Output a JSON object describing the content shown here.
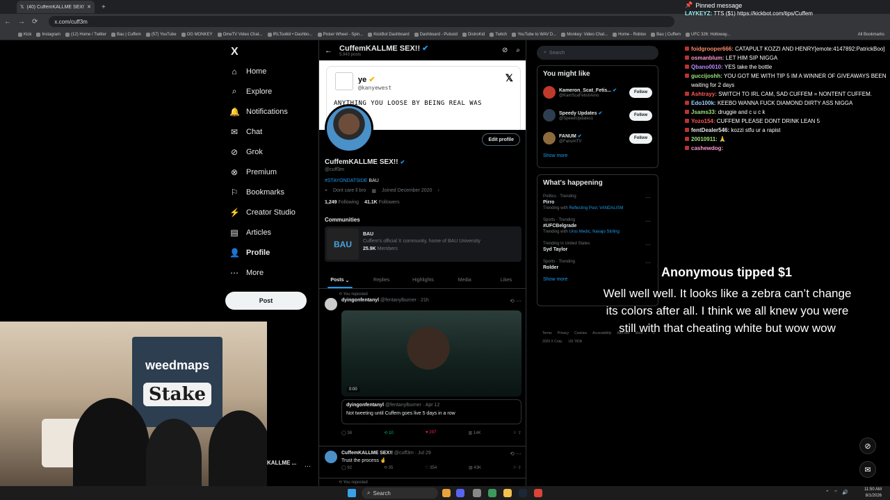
{
  "browser": {
    "tab_title": "(40) CuffemKALLME SEX!! (@cuff3m)",
    "url": "x.com/cuff3m",
    "bookmarks": [
      "Kick",
      "Instagram",
      "(12) Home / Twitter",
      "Bau | Cuffem",
      "(57) YouTube",
      "OG MONKEY",
      "OmeTV Video Chat...",
      "IRLToolkit • Dashbo...",
      "Picker Wheel - Spin...",
      "KickBot Dashboard",
      "Dashboard - Pulsoid",
      "DistroKid",
      "Twitch",
      "YouTube to WAV D...",
      "Monkey: Video Chat...",
      "Home - Roblox",
      "Bau | Cuffem",
      "UFC 326: Holloway..."
    ],
    "all_bookmarks": "All Bookmarks"
  },
  "nav": {
    "logo": "X",
    "items": [
      {
        "label": "Home",
        "icon": "⌂"
      },
      {
        "label": "Explore",
        "icon": "⌕"
      },
      {
        "label": "Notifications",
        "icon": "🔔"
      },
      {
        "label": "Chat",
        "icon": "✉"
      },
      {
        "label": "Grok",
        "icon": "⊘"
      },
      {
        "label": "Premium",
        "icon": "⊗"
      },
      {
        "label": "Bookmarks",
        "icon": "⚐"
      },
      {
        "label": "Creator Studio",
        "icon": "⚡"
      },
      {
        "label": "Articles",
        "icon": "▤"
      },
      {
        "label": "Profile",
        "icon": "👤"
      },
      {
        "label": "More",
        "icon": "⋯"
      }
    ],
    "post_label": "Post"
  },
  "profile": {
    "header_name": "CuffemKALLME SEX!!",
    "header_posts": "5,943 posts",
    "banner": {
      "name": "ye",
      "handle": "@kanyewest",
      "text": "ANYTHING YOU LOOSE BY BEING REAL WAS"
    },
    "edit_label": "Edit profile",
    "name": "CuffemKALLME SEX!!",
    "handle": "@cuff3m",
    "bio_tag": "#STAYONDATSIDE",
    "bio_rest": " BAU",
    "location": "Dont care ll bro",
    "joined": "Joined December 2020",
    "following_count": "1,249",
    "following_label": "Following",
    "followers_count": "41.1K",
    "followers_label": "Followers",
    "communities_title": "Communities",
    "community": {
      "name": "BAU",
      "desc": "Cuffem's official X community, home of BAU University",
      "members_count": "25.9K",
      "members_label": "Members"
    },
    "tabs": [
      "Posts",
      "Replies",
      "Highlights",
      "Media",
      "Likes"
    ]
  },
  "posts": [
    {
      "reposted": "You reposted",
      "name": "dyingonfentanyl",
      "handle": "@fentanylburner · 21h",
      "media_time": "0:00",
      "quote_name": "dyingonfentanyl",
      "quote_handle": "@fentanylburner · Apr 12",
      "quote_text": "Not tweeting until Cuffem goes live 5 days in a row",
      "replies": "38",
      "reposts": "10",
      "likes": "297",
      "views": "14K"
    },
    {
      "name": "CuffemKALLME SEX!!",
      "handle": "@cuff3m · Jul 29",
      "text": "Trust the process 🤞",
      "replies": "92",
      "reposts": "35",
      "likes": "354",
      "views": "43K"
    }
  ],
  "next_repost": "You reposted",
  "right": {
    "search_placeholder": "Search",
    "might_like_title": "You might like",
    "suggestions": [
      {
        "name": "Kameron_Scat_Fetis...",
        "handle": "@KamScaFetishAmo",
        "follow": "Follow"
      },
      {
        "name": "Speedy Updates",
        "handle": "@SpeedUpdates1",
        "follow": "Follow"
      },
      {
        "name": "FANUM",
        "handle": "@FanumTV",
        "follow": "Follow"
      }
    ],
    "show_more": "Show more",
    "happening_title": "What's happening",
    "trends": [
      {
        "cat": "Politics · Trending",
        "title": "Pirro",
        "with_label": "Trending with",
        "with": "Reflecting Pool, VANDALISM"
      },
      {
        "cat": "Sports · Trending",
        "title": "#UFCBelgrade",
        "with_label": "Trending with",
        "with": "Uros Medic, Navajo Stirling"
      },
      {
        "cat": "Trending in United States",
        "title": "Syd Taylor",
        "with_label": "",
        "with": ""
      },
      {
        "cat": "Sports · Trending",
        "title": "Rolder",
        "with_label": "",
        "with": ""
      }
    ],
    "footer": [
      "Terms",
      "Privacy",
      "Cookies",
      "Accessibility",
      "Ads info",
      "More ...",
      "© 2026 X Corp.",
      "US TIDA"
    ]
  },
  "stream": {
    "pinned_title": "Pinned message",
    "pinned_user": "LAYKEYZ:",
    "pinned_text": "TTS ($1) https://kickbot.com/tips/Cuffem",
    "chat": [
      {
        "user": "foidgrooper666:",
        "color": "#ff8c69",
        "text": "CATAPULT KOZZI AND HENRY[emote:4147892:PatrickBoo]"
      },
      {
        "user": "osmanblum:",
        "color": "#ff9ad5",
        "text": "LET HIM SIP NIGGA"
      },
      {
        "user": "Qbano0010:",
        "color": "#b98cff",
        "text": "YES take the bottle"
      },
      {
        "user": "guccijoshh:",
        "color": "#9ee37d",
        "text": "YOU GOT ME WITH TIP 5 IM A WINNER OF GIVEAWAYS BEEN waiting for 2 days"
      },
      {
        "user": "Ashtrayy:",
        "color": "#ff5a5a",
        "text": "SWITCH TO IRL CAM, SAD CUFFEM = NONTENT CUFFEM."
      },
      {
        "user": "Edo100k:",
        "color": "#9ed0ff",
        "text": "KEEBO WANNA FUCK DIAMOND DIRTY ASS NIGGA"
      },
      {
        "user": "Jsams33:",
        "color": "#9ee37d",
        "text": "druggie and c u c k"
      },
      {
        "user": "Yozo154:",
        "color": "#ff5a5a",
        "text": "CUFFEM PLEASE DONT DRINK LEAN 5"
      },
      {
        "user": "fentDealer546:",
        "color": "#e7e9ea",
        "text": "kozzi stfu ur a rapist"
      },
      {
        "user": "20010911:",
        "color": "#9ee37d",
        "text": "🙏"
      },
      {
        "user": "cashewdog:",
        "color": "#ff9ad5",
        "text": ""
      }
    ],
    "tip_title": "Anonymous tipped $1",
    "tip_message": "Well well well. It looks like a zebra can’t change its colors after all. I think we all knew you were still with that cheating white but wow wow",
    "cam_logo": "weedmaps",
    "cam_stake": "Stake",
    "cam_name": "KALLME ..."
  },
  "taskbar": {
    "search": "Search",
    "time": "11:50 AM",
    "date": "8/1/2026"
  }
}
